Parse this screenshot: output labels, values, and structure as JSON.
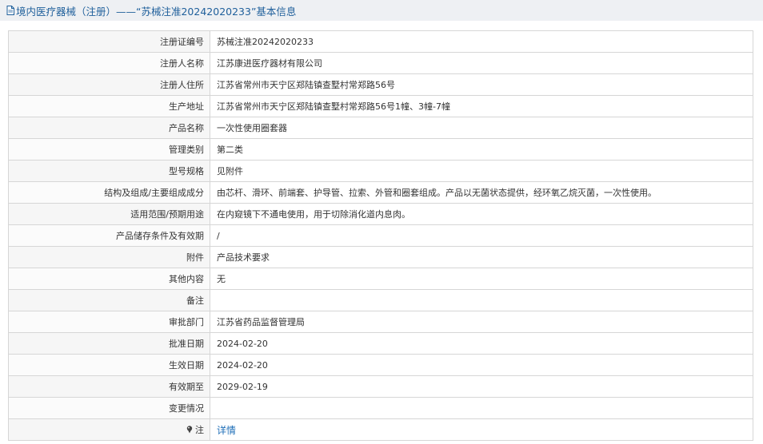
{
  "header": {
    "title": "境内医疗器械（注册）——“苏械注准20242020233”基本信息",
    "icon": "document-icon"
  },
  "rows": [
    {
      "label": "注册证编号",
      "value": "苏械注准20242020233"
    },
    {
      "label": "注册人名称",
      "value": "江苏康进医疗器材有限公司"
    },
    {
      "label": "注册人住所",
      "value": "江苏省常州市天宁区郑陆镇查墅村常郑路56号"
    },
    {
      "label": "生产地址",
      "value": "江苏省常州市天宁区郑陆镇查墅村常郑路56号1幢、3幢-7幢"
    },
    {
      "label": "产品名称",
      "value": "一次性使用圈套器"
    },
    {
      "label": "管理类别",
      "value": "第二类"
    },
    {
      "label": "型号规格",
      "value": "见附件"
    },
    {
      "label": "结构及组成/主要组成成分",
      "value": "由芯杆、滑环、前端套、护导管、拉索、外管和圈套组成。产品以无菌状态提供，经环氧乙烷灭菌，一次性使用。"
    },
    {
      "label": "适用范围/预期用途",
      "value": "在内窥镜下不通电使用，用于切除消化道内息肉。"
    },
    {
      "label": "产品储存条件及有效期",
      "value": "/"
    },
    {
      "label": "附件",
      "value": "产品技术要求"
    },
    {
      "label": "其他内容",
      "value": "无"
    },
    {
      "label": "备注",
      "value": ""
    },
    {
      "label": "审批部门",
      "value": "江苏省药品监督管理局"
    },
    {
      "label": "批准日期",
      "value": "2024-02-20"
    },
    {
      "label": "生效日期",
      "value": "2024-02-20"
    },
    {
      "label": "有效期至",
      "value": "2029-02-19"
    },
    {
      "label": "变更情况",
      "value": ""
    }
  ],
  "footer_row": {
    "label": "注",
    "icon": "pin-icon",
    "link_text": "详情"
  },
  "colors": {
    "title_text": "#1f5f9b",
    "title_bg": "#eef0f3",
    "border": "#d6d6d6",
    "link": "#1f6fb8"
  }
}
